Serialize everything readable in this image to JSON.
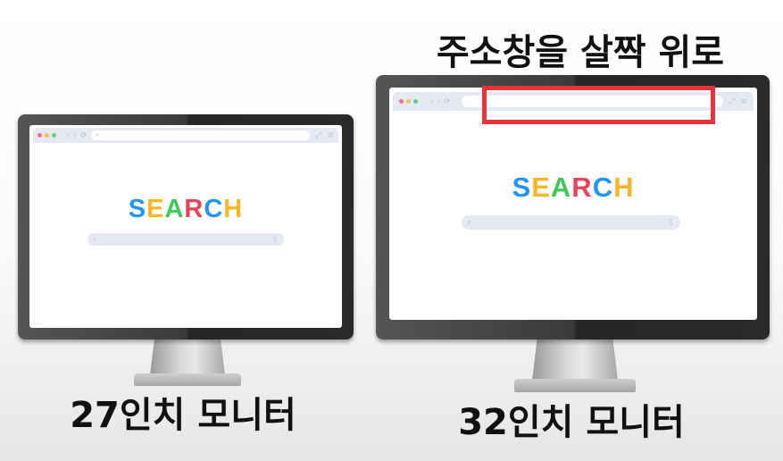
{
  "title": "주소창을 살짝 위로",
  "monitors": [
    {
      "label": "27인치 모니터",
      "logo": "SEARCH"
    },
    {
      "label": "32인치 모니터",
      "logo": "SEARCH"
    }
  ],
  "logo_letters": [
    "S",
    "E",
    "A",
    "R",
    "C",
    "H"
  ],
  "colors": {
    "S": "#2196f3",
    "E": "#fbb627",
    "A": "#3ec95a",
    "R": "#e8435a",
    "C": "#2196f3",
    "H": "#fbb627",
    "highlight": "#e8333a"
  },
  "icons": {
    "back": "‹",
    "forward": "›",
    "reload": "⟳",
    "search": "⌕",
    "mic": "🎙",
    "expand": "⤢",
    "menu": "≡"
  }
}
